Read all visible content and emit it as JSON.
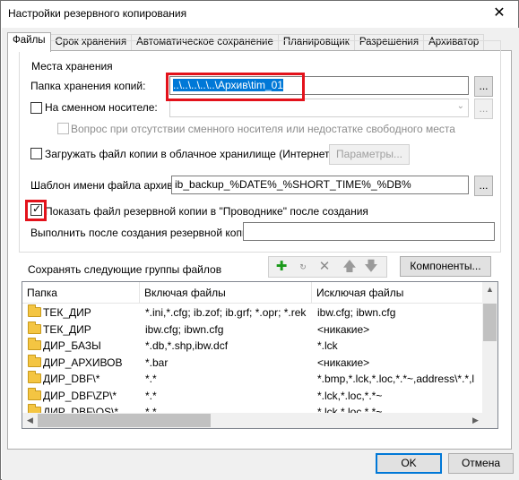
{
  "window": {
    "title": "Настройки резервного копирования",
    "close_glyph": "✕"
  },
  "tabs": [
    {
      "label": "Файлы",
      "active": true
    },
    {
      "label": "Срок хранения",
      "active": false
    },
    {
      "label": "Автоматическое сохранение",
      "active": false
    },
    {
      "label": "Планировщик",
      "active": false
    },
    {
      "label": "Разрешения",
      "active": false
    },
    {
      "label": "Архиватор",
      "active": false
    }
  ],
  "storage": {
    "group_title": "Места хранения",
    "folder_label": "Папка хранения копий:",
    "folder_value": "..\\..\\..\\..\\..\\Архив\\tim_01",
    "browse_label": "...",
    "removable_label": "На сменном носителе:",
    "removable_checked": false,
    "ask_label": "Вопрос при отсутствии сменного носителя или недостатке свободного места",
    "cloud_label": "Загружать файл копии в облачное хранилище (Интернет)",
    "cloud_checked": false,
    "params_label": "Параметры...",
    "template_label": "Шаблон имени файла архива:",
    "template_value": "ib_backup_%DATE%_%SHORT_TIME%_%DB%",
    "explorer_label": "Показать файл резервной копии в \"Проводнике\" после создания",
    "explorer_checked": true,
    "after_label": "Выполнить после создания резервной копии",
    "after_value": ""
  },
  "groups": {
    "title": "Сохранять следующие группы файлов",
    "components_label": "Компоненты...",
    "toolbar_icons": [
      "add-icon",
      "rotate-icon",
      "delete-icon",
      "move-up-icon",
      "move-down-icon"
    ],
    "columns": [
      "Папка",
      "Включая файлы",
      "Исключая файлы"
    ],
    "rows": [
      {
        "folder": "ТЕК_ДИР",
        "include": "*.ini,*.cfg; ib.zof; ib.grf; *.opr; *.rek",
        "exclude": "ibw.cfg; ibwn.cfg"
      },
      {
        "folder": "ТЕК_ДИР",
        "include": "ibw.cfg; ibwn.cfg",
        "exclude": "<никакие>"
      },
      {
        "folder": "ДИР_БАЗЫ",
        "include": "*.db,*.shp,ibw.dcf",
        "exclude": "*.lck"
      },
      {
        "folder": "ДИР_АРХИВОВ",
        "include": "*.bar",
        "exclude": "<никакие>"
      },
      {
        "folder": "ДИР_DBF\\*",
        "include": "*.*",
        "exclude": "*.bmp,*.lck,*.loc,*.*~,address\\*.*,l"
      },
      {
        "folder": "ДИР_DBF\\ZP\\*",
        "include": "*.*",
        "exclude": "*.lck,*.loc,*.*~"
      },
      {
        "folder": "ДИР_DBF\\OS\\*",
        "include": "*.*",
        "exclude": "*.lck,*.loc,*.*~"
      }
    ]
  },
  "footer": {
    "ok_label": "OK",
    "cancel_label": "Отмена"
  },
  "colors": {
    "highlight": "#e3121b",
    "selection": "#0078d7"
  }
}
